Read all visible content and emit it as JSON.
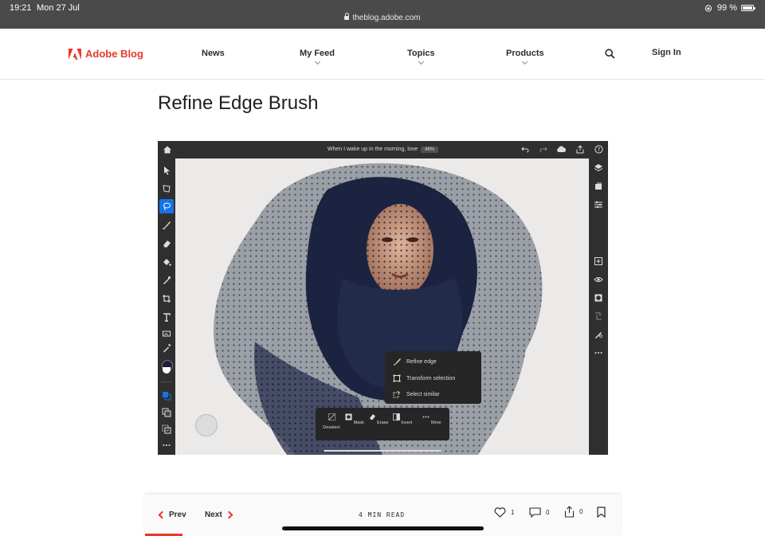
{
  "status_bar": {
    "time": "19:21",
    "date": "Mon 27 Jul",
    "url": "theblog.adobe.com",
    "battery": "99 %",
    "battery_level": 0.99
  },
  "header": {
    "brand": "Adobe Blog",
    "nav": [
      "News",
      "My Feed",
      "Topics",
      "Products"
    ],
    "signin": "Sign In",
    "brand_color": "#e8392b"
  },
  "article": {
    "title": "Refine Edge Brush"
  },
  "app_screenshot": {
    "document_title": "When I wake up in the morning, love",
    "zoom": "46%",
    "popup_menu": [
      "Refine edge",
      "Transform selection",
      "Select similar"
    ],
    "bottom_actions": [
      "Deselect",
      "Mask",
      "Erase",
      "Invert",
      "More"
    ]
  },
  "footer": {
    "prev": "Prev",
    "next": "Next",
    "read_time": "4 MIN READ",
    "likes": "1",
    "comments": "0",
    "shares": "0"
  }
}
